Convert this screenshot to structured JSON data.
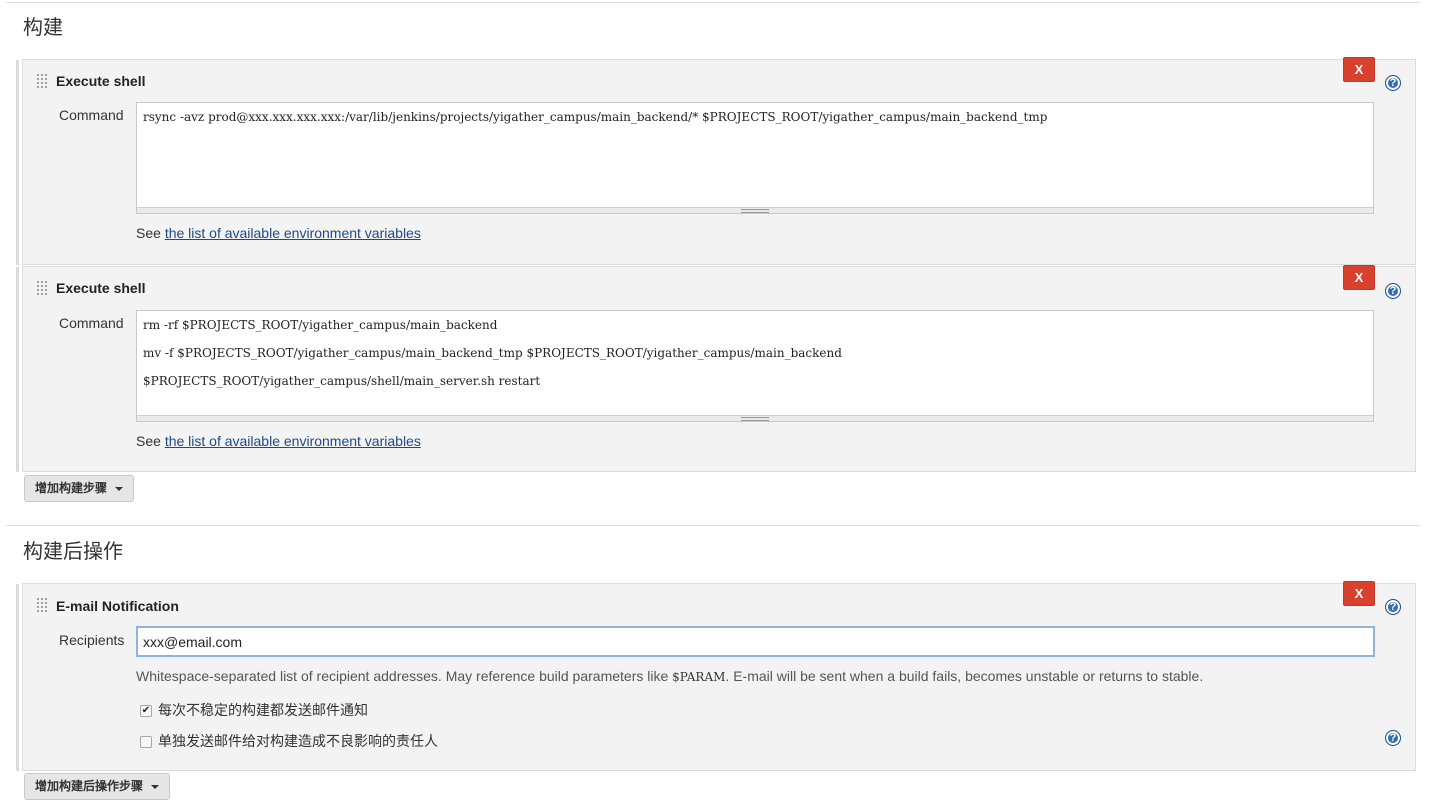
{
  "build_section": {
    "title": "构建",
    "steps": [
      {
        "title": "Execute shell",
        "delete_label": "X",
        "command_label": "Command",
        "command_lines": [
          "rsync -avz prod@xxx.xxx.xxx.xxx:/var/lib/jenkins/projects/yigather_campus/main_backend/* $PROJECTS_ROOT/yigather_campus/main_backend_tmp"
        ],
        "see_prefix": "See",
        "env_link": "the list of available environment variables"
      },
      {
        "title": "Execute shell",
        "delete_label": "X",
        "command_label": "Command",
        "command_lines": [
          "rm -rf $PROJECTS_ROOT/yigather_campus/main_backend",
          "mv -f $PROJECTS_ROOT/yigather_campus/main_backend_tmp $PROJECTS_ROOT/yigather_campus/main_backend",
          "$PROJECTS_ROOT/yigather_campus/shell/main_server.sh restart"
        ],
        "see_prefix": "See",
        "env_link": "the list of available environment variables"
      }
    ],
    "add_step_label": "增加构建步骤"
  },
  "post_build_section": {
    "title": "构建后操作",
    "email": {
      "title": "E-mail Notification",
      "delete_label": "X",
      "recipients_label": "Recipients",
      "recipients_value": "xxx@email.com",
      "hint_before": "Whitespace-separated list of recipient addresses. May reference build parameters like ",
      "hint_param": "$PARAM",
      "hint_after": ". E-mail will be sent when a build fails, becomes unstable or returns to stable.",
      "checkbox_unstable": {
        "label": "每次不稳定的构建都发送邮件通知",
        "checked": true
      },
      "checkbox_culprits": {
        "label": "单独发送邮件给对构建造成不良影响的责任人",
        "checked": false
      }
    },
    "add_step_label": "增加构建后操作步骤"
  },
  "colors": {
    "delete_button": "#d9412f",
    "help_icon": "#2f6fb0",
    "link": "#204a87",
    "panel_bg": "#f3f3f3"
  }
}
